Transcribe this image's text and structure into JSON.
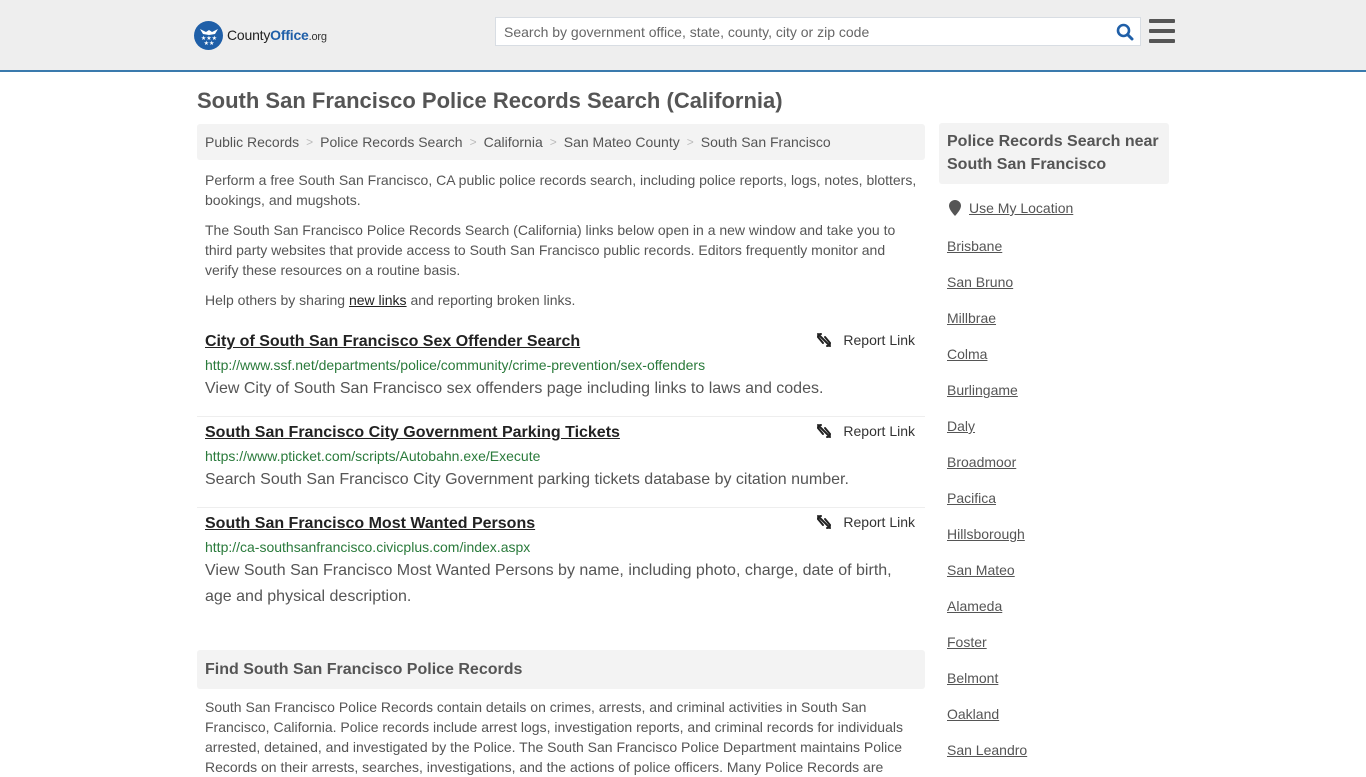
{
  "header": {
    "logo": {
      "brand_first": "County",
      "brand_second": "Office",
      "brand_tld": ".org",
      "icon": "eagle-stars-badge-icon"
    },
    "search": {
      "placeholder": "Search by government office, state, county, city or zip code",
      "value": "",
      "icon": "search-icon"
    },
    "menu_icon": "hamburger-menu-icon"
  },
  "colors": {
    "brand_blue": "#1f5fa8",
    "header_border": "#3a7aad",
    "url_green": "#2a7a3b",
    "panel_gray": "#f3f3f3"
  },
  "page_title": "South San Francisco Police Records Search (California)",
  "breadcrumb": [
    {
      "label": "Public Records"
    },
    {
      "label": "Police Records Search"
    },
    {
      "label": "California"
    },
    {
      "label": "San Mateo County"
    },
    {
      "label": "South San Francisco"
    }
  ],
  "breadcrumb_separator": ">",
  "intro": {
    "p1": "Perform a free South San Francisco, CA public police records search, including police reports, logs, notes, blotters, bookings, and mugshots.",
    "p2": "The South San Francisco Police Records Search (California) links below open in a new window and take you to third party websites that provide access to South San Francisco public records. Editors frequently monitor and verify these resources on a routine basis.",
    "p3_before": "Help others by sharing ",
    "p3_link": "new links",
    "p3_after": " and reporting broken links."
  },
  "results": [
    {
      "title": "City of South San Francisco Sex Offender Search",
      "url": "http://www.ssf.net/departments/police/community/crime-prevention/sex-offenders",
      "description": "View City of South San Francisco sex offenders page including links to laws and codes.",
      "report_label": "Report Link"
    },
    {
      "title": "South San Francisco City Government Parking Tickets",
      "url": "https://www.pticket.com/scripts/Autobahn.exe/Execute",
      "description": "Search South San Francisco City Government parking tickets database by citation number.",
      "report_label": "Report Link"
    },
    {
      "title": "South San Francisco Most Wanted Persons",
      "url": "http://ca-southsanfrancisco.civicplus.com/index.aspx",
      "description": "View South San Francisco Most Wanted Persons by name, including photo, charge, date of birth, age and physical description.",
      "report_label": "Report Link"
    }
  ],
  "find_section": {
    "heading": "Find South San Francisco Police Records",
    "body": "South San Francisco Police Records contain details on crimes, arrests, and criminal activities in South San Francisco, California. Police records include arrest logs, investigation reports, and criminal records for individuals arrested, detained, and investigated by the Police. The South San Francisco Police Department maintains Police Records on their arrests, searches, investigations, and the actions of police officers. Many Police Records are"
  },
  "sidebar": {
    "heading": "Police Records Search near South San Francisco",
    "use_location": "Use My Location",
    "nearby": [
      "Brisbane",
      "San Bruno",
      "Millbrae",
      "Colma",
      "Burlingame",
      "Daly",
      "Broadmoor",
      "Pacifica",
      "Hillsborough",
      "San Mateo",
      "Alameda",
      "Foster",
      "Belmont",
      "Oakland",
      "San Leandro"
    ]
  }
}
